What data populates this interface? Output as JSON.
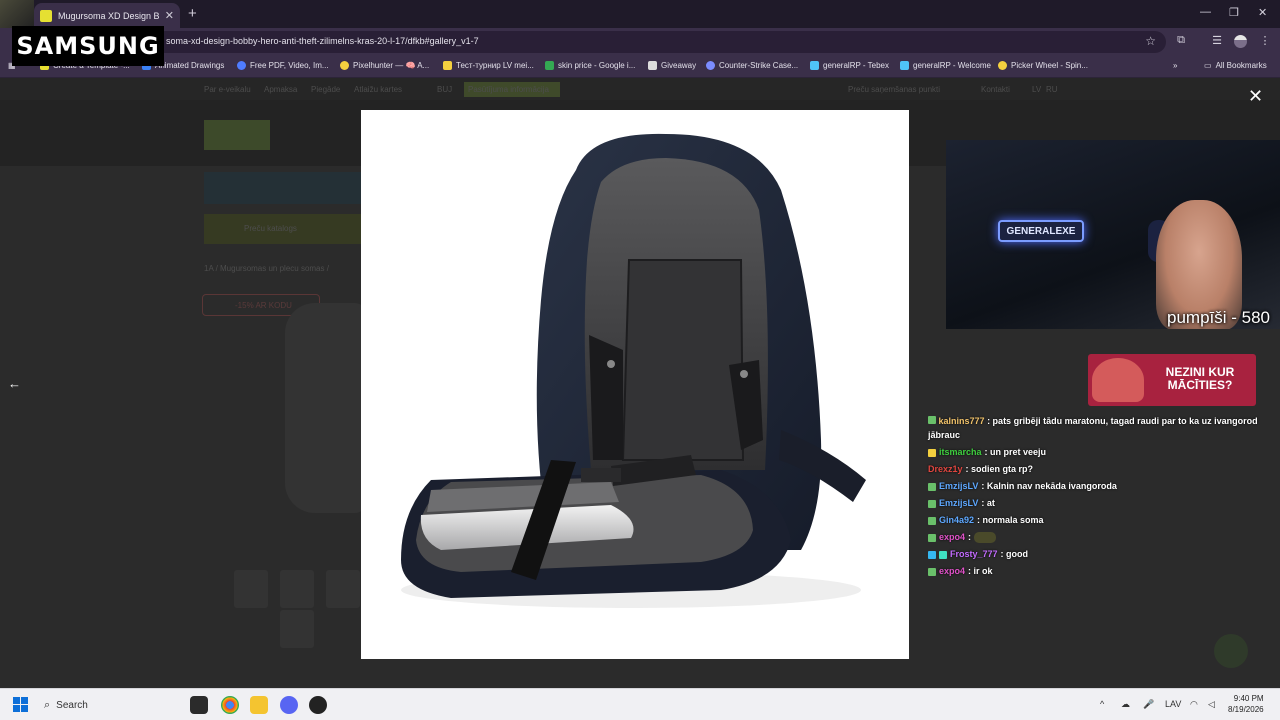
{
  "browser": {
    "tab_title": "Mugursoma XD Design Bobby H",
    "new_tab": "+",
    "url": "soma-xd-design-bobby-hero-anti-theft-zilimelns-kras-20-l-17/dfkb#gallery_v1-7",
    "window_controls": {
      "minimize": "—",
      "restore": "❐",
      "close": "✕"
    },
    "bookmarks": [
      {
        "label": "Create a Template -...",
        "color": "#e8e032"
      },
      {
        "label": "Animated Drawings",
        "color": "#3b82f6"
      },
      {
        "label": "Free PDF, Video, Im...",
        "color": "#4f7cff"
      },
      {
        "label": "Pixelhunter — 🧠 A...",
        "color": "#f4d03f"
      },
      {
        "label": "Тест-турнир LV mei...",
        "color": "#f4d03f"
      },
      {
        "label": "skin price - Google i...",
        "color": "#34a853"
      },
      {
        "label": "Giveaway",
        "color": "#dddddd"
      },
      {
        "label": "Counter-Strike Case...",
        "color": "#7b8cff"
      },
      {
        "label": "generalRP - Tebex",
        "color": "#4fc3f7"
      },
      {
        "label": "generalRP - Welcome",
        "color": "#4fc3f7"
      },
      {
        "label": "Picker Wheel - Spin...",
        "color": "#f4d03f"
      }
    ],
    "more_bookmarks": "»",
    "all_bookmarks": "All Bookmarks"
  },
  "samsung_logo": "SAMSUNG",
  "page": {
    "nav_items": [
      "Par e-veikalu",
      "Apmaksa",
      "Piegāde",
      "Atlaižu kartes",
      "BUJ",
      "Pasūtījuma informācija"
    ],
    "nav_right": [
      "Preču saņemšanas punkti",
      "Kontakti",
      "LV",
      "RU"
    ],
    "catalog_button": "Preču katalogs",
    "badge": "-15% AR KODU",
    "breadcrumb": "1A  /  Mugursomas un plecu somas  /"
  },
  "lightbox": {
    "close": "✕",
    "prev": "←"
  },
  "stream": {
    "neon_sign": "GENERALEXE",
    "counter": "pumpīši - 580",
    "promo": "NEZINI KUR MĀCĪTIES?"
  },
  "chat": [
    {
      "user": "kalnins777",
      "color": "#f0c26a",
      "badge": "#6ac06a",
      "text": ": pats gribēji tādu maratonu, tagad raudi par to ka uz ivangorod jābrauc",
      "wrap": true
    },
    {
      "user": "itsmarcha",
      "color": "#3fcf3f",
      "badge": "#f4d03f",
      "text": ": un pret veeju"
    },
    {
      "user": "Drexz1y",
      "color": "#e0463f",
      "badge": null,
      "text": ": sodien gta rp?"
    },
    {
      "user": "EmzijsLV",
      "color": "#5ea8ff",
      "badge": "#6ac06a",
      "text": ": Kalnin nav nekāda ivangoroda"
    },
    {
      "user": "EmzijsLV",
      "color": "#5ea8ff",
      "badge": "#6ac06a",
      "text": ": at"
    },
    {
      "user": "Gin4a92",
      "color": "#5ea8ff",
      "badge": "#6ac06a",
      "text": ": normala soma"
    },
    {
      "user": "expo4",
      "color": "#e052c8",
      "badge": "#6ac06a",
      "text": ":",
      "emote": true
    },
    {
      "user": "Frosty_777",
      "color": "#c36bff",
      "badge": "#35b7f0",
      "text": ": good"
    },
    {
      "user": "expo4",
      "color": "#e052c8",
      "badge": "#6ac06a",
      "text": ": ir ok"
    }
  ],
  "taskbar": {
    "search_placeholder": "Search",
    "lang": "LAV",
    "time": "9:40 PM",
    "date": "8/19/2026"
  }
}
